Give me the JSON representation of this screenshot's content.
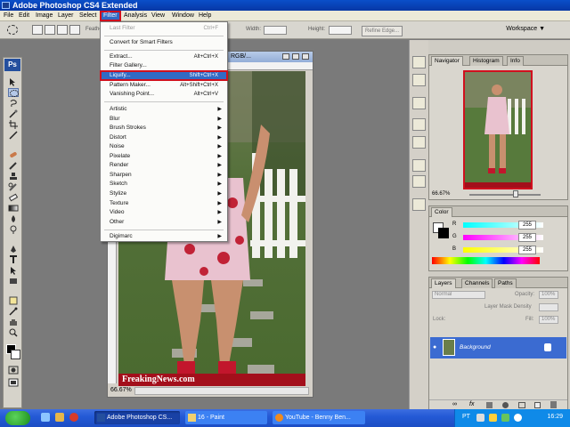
{
  "app": {
    "title": "Adobe Photoshop CS4 Extended"
  },
  "menu": [
    "File",
    "Edit",
    "Image",
    "Layer",
    "Select",
    "Filter",
    "Analysis",
    "View",
    "Window",
    "Help"
  ],
  "options": {
    "feather": "Feathe",
    "width": "Width:",
    "height": "Height:",
    "refine": "Refine Edge...",
    "workspace": "Workspace"
  },
  "filter_menu": {
    "last_filter": "Last Filter",
    "last_filter_shortcut": "Ctrl+F",
    "convert": "Convert for Smart Filters",
    "extract": "Extract...",
    "extract_shortcut": "Alt+Ctrl+X",
    "gallery": "Filter Gallery...",
    "liquify": "Liquify...",
    "liquify_shortcut": "Shift+Ctrl+X",
    "pattern": "Pattern Maker...",
    "pattern_shortcut": "Alt+Shift+Ctrl+X",
    "vanishing": "Vanishing Point...",
    "vanishing_shortcut": "Alt+Ctrl+V",
    "submenus": [
      "Artistic",
      "Blur",
      "Brush Strokes",
      "Distort",
      "Noise",
      "Pixelate",
      "Render",
      "Sharpen",
      "Sketch",
      "Stylize",
      "Texture",
      "Video",
      "Other"
    ],
    "digimarc": "Digimarc"
  },
  "document": {
    "title_fragment": "RGB/...",
    "zoom": "66.67%",
    "watermark": "FreakingNews.com"
  },
  "panels": {
    "navigator_tabs": [
      "Navigator",
      "Histogram",
      "Info"
    ],
    "navigator_zoom": "66.67%",
    "color_tab": "Color",
    "color_channels": [
      {
        "label": "R",
        "value": "255"
      },
      {
        "label": "G",
        "value": "255"
      },
      {
        "label": "B",
        "value": "255"
      }
    ],
    "layers_tabs": [
      "Layers",
      "Channels",
      "Paths"
    ],
    "blend_mode": "Normal",
    "opacity_label": "Opacity:",
    "opacity_value": "100%",
    "mask_density": "Layer Mask Density",
    "lock_label": "Lock:",
    "fill_label": "Fill:",
    "fill_value": "100%",
    "layer_name": "Background"
  },
  "taskbar": {
    "tasks": [
      "Adobe Photoshop CS...",
      "16 - Paint",
      "YouTube - Benny Ben..."
    ],
    "language": "PT",
    "clock": "16:29"
  },
  "colors": {
    "highlight": "#316ac5",
    "callout": "#d0101e",
    "taskbar": "#245ad6"
  }
}
